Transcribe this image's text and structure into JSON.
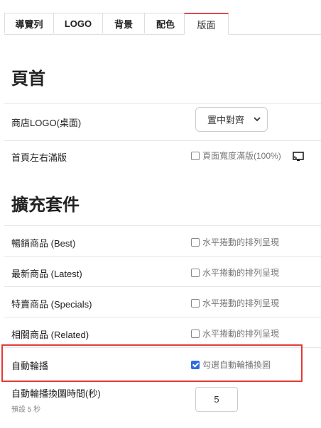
{
  "tabs": [
    {
      "label": "導覽列"
    },
    {
      "label": "LOGO"
    },
    {
      "label": "背景"
    },
    {
      "label": "配色"
    },
    {
      "label": "版面",
      "active": true
    }
  ],
  "header_section": {
    "title": "頁首",
    "store_logo": {
      "label": "商店LOGO(桌面)",
      "selected": "置中對齊"
    },
    "full_width": {
      "label": "首頁左右滿版",
      "checkbox_label": "頁面寬度滿版(100%)",
      "checked": false,
      "icon": "fullscreen-icon"
    }
  },
  "extensions_section": {
    "title": "擴充套件",
    "rows": [
      {
        "label": "暢銷商品 (Best)",
        "checkbox_label": "水平捲動的排列呈現",
        "checked": false
      },
      {
        "label": "最新商品 (Latest)",
        "checkbox_label": "水平捲動的排列呈現",
        "checked": false
      },
      {
        "label": "特賣商品 (Specials)",
        "checkbox_label": "水平捲動的排列呈現",
        "checked": false
      },
      {
        "label": "相關商品 (Related)",
        "checkbox_label": "水平捲動的排列呈現",
        "checked": false
      }
    ],
    "autoplay": {
      "label": "自動輪播",
      "checkbox_label": "勾選自動輪播換圖",
      "checked": true
    },
    "autoplay_interval": {
      "label": "自動輪播換圖時間(秒)",
      "hint": "預設 5 秒",
      "value": "5"
    }
  },
  "colors": {
    "highlight": "#e53935",
    "tab_accent": "#e0484e",
    "checkbox_checked": "#2d6ae3"
  }
}
